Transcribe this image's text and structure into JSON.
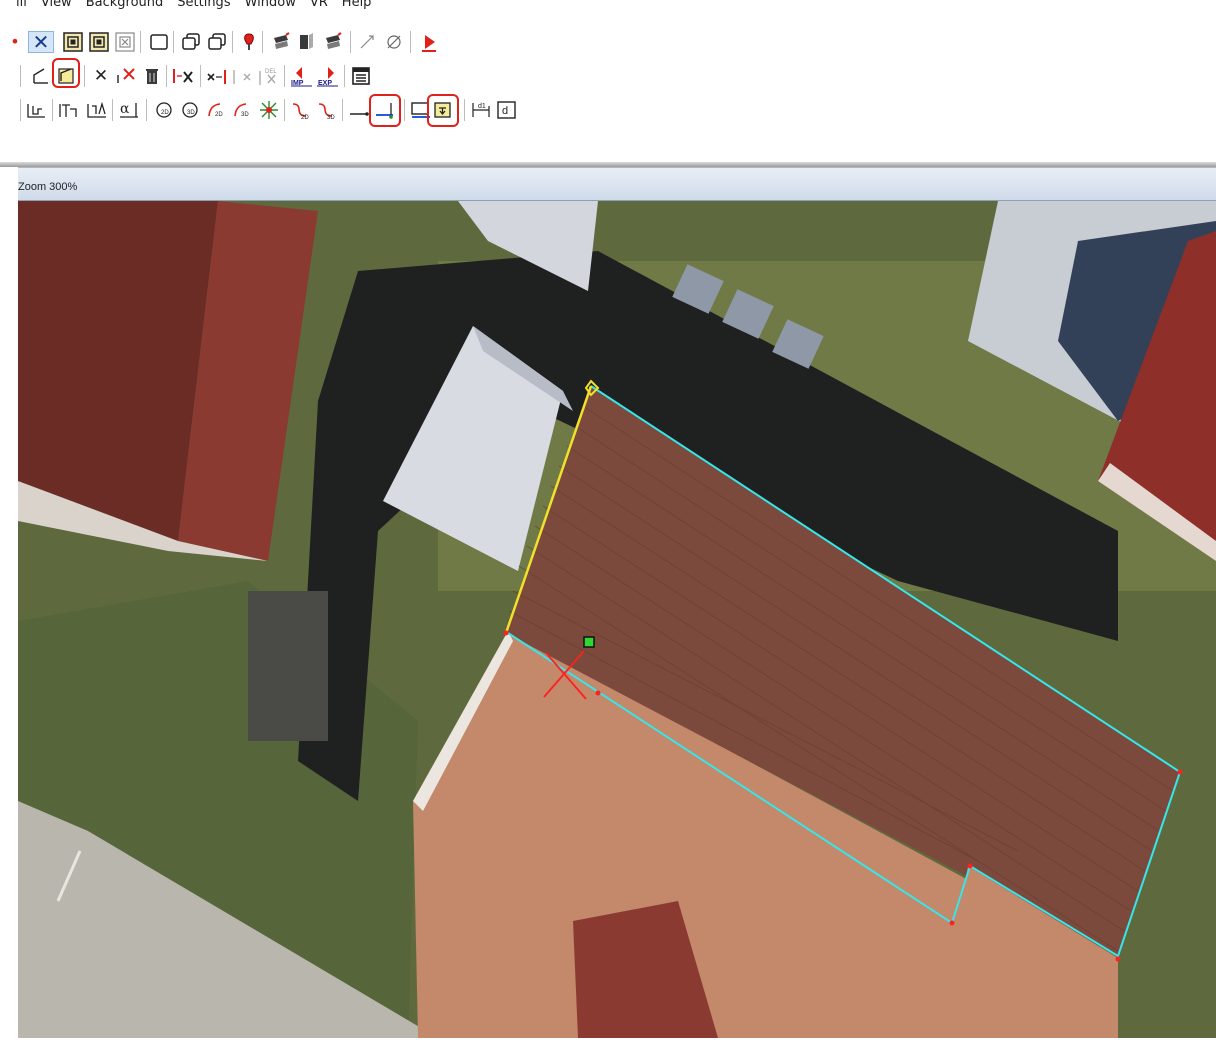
{
  "menu": {
    "items": [
      "ill",
      "View",
      "Background",
      "Settings",
      "Window",
      "VR",
      "Help"
    ]
  },
  "toolbar1": {
    "buttons": [
      "dot",
      "close-x",
      "frame-a",
      "frame-b",
      "frame-x",
      "window",
      "window-stack-a",
      "window-stack-b",
      "pin",
      "rotate-a",
      "book",
      "rotate-b",
      "walk-a",
      "walk-b",
      "record"
    ]
  },
  "toolbar2": {
    "buttons": [
      "draw-line",
      "draw-edge",
      "delete-x",
      "delete-point",
      "trash",
      "move-x",
      "move-x-2",
      "move-x-3",
      "delete-all",
      "import",
      "export",
      "window-panel"
    ],
    "import_label": "IMP",
    "export_label": "EXP",
    "del_label": "DEL"
  },
  "toolbar3": {
    "buttons": [
      "grid-a",
      "grid-b",
      "grid-c",
      "alpha",
      "circle-2d",
      "circle-3d",
      "arc-2d",
      "arc-3d",
      "radial",
      "curve-2d",
      "curve-3d",
      "baseline",
      "baseline-highlighted",
      "box",
      "box-down-highlighted",
      "dimension-1",
      "dimension-d"
    ],
    "alpha_label": "α",
    "d_label": "d",
    "d1_label": "d1",
    "sub_2d": "2D",
    "sub_3d": "3D"
  },
  "viewport": {
    "zoom_label": "Zoom 300%"
  },
  "colors": {
    "highlight": "#e0201a",
    "cyan_outline": "#36e6ea",
    "yellow_edge": "#f2e12a",
    "cursor_red": "#ff2020",
    "handle_green": "#32d632",
    "roof_dark": "#7b4a3c",
    "roof_orange": "#c98a6a"
  }
}
